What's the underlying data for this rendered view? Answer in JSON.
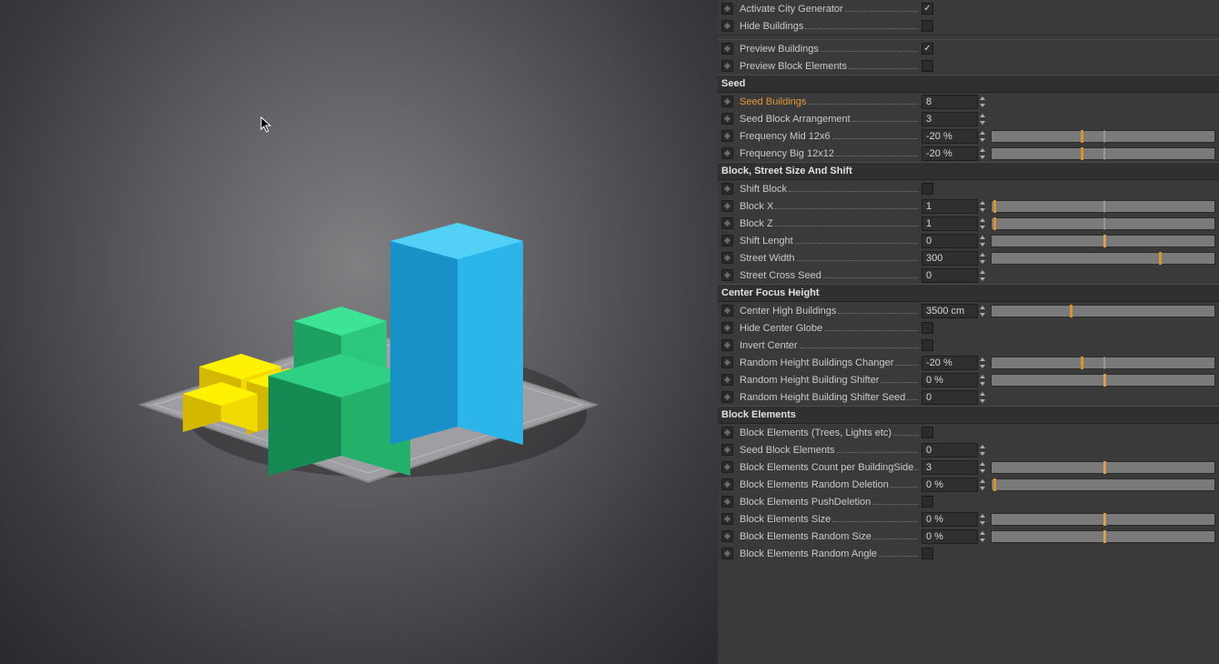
{
  "general": [
    {
      "label": "Activate City Generator",
      "type": "checkbox",
      "value": true
    },
    {
      "label": "Hide Buildings",
      "type": "checkbox",
      "value": false
    }
  ],
  "preview": [
    {
      "label": "Preview Buildings",
      "type": "checkbox",
      "value": true
    },
    {
      "label": "Preview Block Elements",
      "type": "checkbox",
      "value": false
    }
  ],
  "sections": [
    {
      "title": "Seed",
      "rows": [
        {
          "label": "Seed Buildings",
          "type": "number",
          "value": "8",
          "highlight": true
        },
        {
          "label": "Seed Block Arrangement",
          "type": "number",
          "value": "3"
        },
        {
          "label": "Frequency Mid 12x6",
          "type": "slider",
          "value": "-20 %",
          "tick": 40,
          "edge": 50
        },
        {
          "label": "Frequency Big 12x12",
          "type": "slider",
          "value": "-20 %",
          "tick": 40,
          "edge": 50
        }
      ]
    },
    {
      "title": "Block, Street Size And Shift",
      "rows": [
        {
          "label": "Shift Block",
          "type": "checkbox",
          "value": false
        },
        {
          "label": "Block X",
          "type": "slider",
          "value": "1",
          "tick": 1,
          "edge": 50
        },
        {
          "label": "Block Z",
          "type": "slider",
          "value": "1",
          "tick": 1,
          "edge": 50
        },
        {
          "label": "Shift Lenght",
          "type": "slider",
          "value": "0",
          "tick": 50,
          "edge": 50
        },
        {
          "label": "Street Width",
          "type": "slider",
          "value": "300",
          "tick": 75,
          "edge": 0
        },
        {
          "label": "Street Cross Seed",
          "type": "number",
          "value": "0"
        }
      ]
    },
    {
      "title": "Center Focus Height",
      "rows": [
        {
          "label": "Center High Buildings",
          "type": "slider",
          "value": "3500 cm",
          "tick": 35,
          "edge": 0
        },
        {
          "label": "Hide Center Globe",
          "type": "checkbox",
          "value": false
        },
        {
          "label": "Invert Center",
          "type": "checkbox",
          "value": false
        },
        {
          "label": "Random Height Buildings Changer",
          "type": "slider",
          "value": "-20 %",
          "tick": 40,
          "edge": 50
        },
        {
          "label": "Random Height Building Shifter",
          "type": "slider",
          "value": "0 %",
          "tick": 50,
          "edge": 50
        },
        {
          "label": "Random Height Building Shifter Seed",
          "type": "number",
          "value": "0"
        }
      ]
    },
    {
      "title": "Block Elements",
      "rows": [
        {
          "label": "Block Elements (Trees, Lights etc)",
          "type": "checkbox",
          "value": false
        },
        {
          "label": "Seed Block Elements",
          "type": "number",
          "value": "0"
        },
        {
          "label": "Block Elements Count per BuildingSide",
          "type": "slider",
          "value": "3",
          "tick": 50,
          "edge": 50
        },
        {
          "label": "Block Elements Random Deletion",
          "type": "slider",
          "value": "0 %",
          "tick": 1,
          "edge": 0
        },
        {
          "label": "Block Elements PushDeletion",
          "type": "checkbox",
          "value": false
        },
        {
          "label": "Block Elements Size",
          "type": "slider",
          "value": "0 %",
          "tick": 50,
          "edge": 50
        },
        {
          "label": "Block Elements Random Size",
          "type": "slider",
          "value": "0 %",
          "tick": 50,
          "edge": 50
        },
        {
          "label": "Block Elements Random Angle",
          "type": "checkbox",
          "value": false
        }
      ]
    }
  ]
}
